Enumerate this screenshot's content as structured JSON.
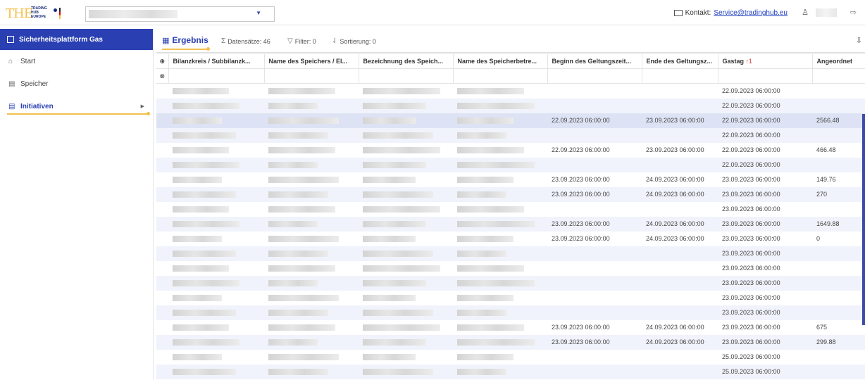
{
  "header": {
    "logo_text": "THE",
    "logo_sub": "TRADING HUB EUROPE",
    "contact_label": "Kontakt:",
    "contact_email": "Service@tradinghub.eu"
  },
  "sidebar": {
    "title": "Sicherheitsplattform Gas",
    "items": [
      {
        "label": "Start",
        "icon": "home-icon"
      },
      {
        "label": "Speicher",
        "icon": "database-icon"
      },
      {
        "label": "Initiativen",
        "icon": "list-icon"
      }
    ]
  },
  "toolbar": {
    "tab_label": "Ergebnis",
    "records": "Datensätze: 46",
    "filter": "Filter: 0",
    "sort": "Sortierung: 0"
  },
  "table": {
    "columns": [
      "Bilanzkreis / Subbilanzk...",
      "Name des Speichers / El...",
      "Bezeichnung des Speich...",
      "Name des Speicherbetre...",
      "Beginn des Geltungszeit...",
      "Ende des Geltungsz...",
      "Gastag",
      "Angeordnet"
    ],
    "sort_indicator": "↑1",
    "rows": [
      {
        "beginn": "",
        "ende": "",
        "gastag": "22.09.2023 06:00:00",
        "wert": ""
      },
      {
        "beginn": "",
        "ende": "",
        "gastag": "22.09.2023 06:00:00",
        "wert": ""
      },
      {
        "beginn": "22.09.2023 06:00:00",
        "ende": "23.09.2023 06:00:00",
        "gastag": "22.09.2023 06:00:00",
        "wert": "2566.48"
      },
      {
        "beginn": "",
        "ende": "",
        "gastag": "22.09.2023 06:00:00",
        "wert": ""
      },
      {
        "beginn": "22.09.2023 06:00:00",
        "ende": "23.09.2023 06:00:00",
        "gastag": "22.09.2023 06:00:00",
        "wert": "466.48"
      },
      {
        "beginn": "",
        "ende": "",
        "gastag": "22.09.2023 06:00:00",
        "wert": ""
      },
      {
        "beginn": "23.09.2023 06:00:00",
        "ende": "24.09.2023 06:00:00",
        "gastag": "23.09.2023 06:00:00",
        "wert": "149.76"
      },
      {
        "beginn": "23.09.2023 06:00:00",
        "ende": "24.09.2023 06:00:00",
        "gastag": "23.09.2023 06:00:00",
        "wert": "270"
      },
      {
        "beginn": "",
        "ende": "",
        "gastag": "23.09.2023 06:00:00",
        "wert": ""
      },
      {
        "beginn": "23.09.2023 06:00:00",
        "ende": "24.09.2023 06:00:00",
        "gastag": "23.09.2023 06:00:00",
        "wert": "1649.88"
      },
      {
        "beginn": "23.09.2023 06:00:00",
        "ende": "24.09.2023 06:00:00",
        "gastag": "23.09.2023 06:00:00",
        "wert": "0"
      },
      {
        "beginn": "",
        "ende": "",
        "gastag": "23.09.2023 06:00:00",
        "wert": ""
      },
      {
        "beginn": "",
        "ende": "",
        "gastag": "23.09.2023 06:00:00",
        "wert": ""
      },
      {
        "beginn": "",
        "ende": "",
        "gastag": "23.09.2023 06:00:00",
        "wert": ""
      },
      {
        "beginn": "",
        "ende": "",
        "gastag": "23.09.2023 06:00:00",
        "wert": ""
      },
      {
        "beginn": "",
        "ende": "",
        "gastag": "23.09.2023 06:00:00",
        "wert": ""
      },
      {
        "beginn": "23.09.2023 06:00:00",
        "ende": "24.09.2023 06:00:00",
        "gastag": "23.09.2023 06:00:00",
        "wert": "675"
      },
      {
        "beginn": "23.09.2023 06:00:00",
        "ende": "24.09.2023 06:00:00",
        "gastag": "23.09.2023 06:00:00",
        "wert": "299.88"
      },
      {
        "beginn": "",
        "ende": "",
        "gastag": "25.09.2023 06:00:00",
        "wert": ""
      },
      {
        "beginn": "",
        "ende": "",
        "gastag": "25.09.2023 06:00:00",
        "wert": ""
      }
    ]
  },
  "colors": {
    "primary": "#2a3fb2",
    "accent": "#f2c14e",
    "row_alt": "#f0f3fb",
    "row_selected": "#dde3f5"
  }
}
